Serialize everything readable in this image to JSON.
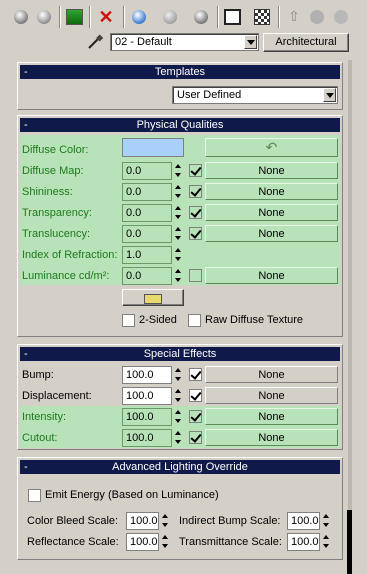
{
  "toolbar": {
    "icons": [
      "get-material-icon",
      "put-to-scene-icon",
      "assign-icon",
      "reset-icon",
      "copy-icon",
      "unique-icon",
      "put-to-library-icon",
      "material-effects-icon",
      "show-map-icon",
      "show-end-icon",
      "go-parent-icon",
      "go-sibling-icon"
    ]
  },
  "material_name": "02 - Default",
  "material_type": "Architectural",
  "templates": {
    "title": "Templates",
    "selected": "User Defined"
  },
  "physical": {
    "title": "Physical Qualities",
    "diffuse_color_label": "Diffuse Color:",
    "diffuse_color": "#a8d0f8",
    "diffuse_map_label": "Diffuse Map:",
    "diffuse_map_value": "0.0",
    "shininess_label": "Shininess:",
    "shininess_value": "0.0",
    "transparency_label": "Transparency:",
    "transparency_value": "0.0",
    "translucency_label": "Translucency:",
    "translucency_value": "0.0",
    "ior_label": "Index of Refraction:",
    "ior_value": "1.0",
    "luminance_label": "Luminance cd/m²:",
    "luminance_value": "0.0",
    "none": "None",
    "two_sided": "2-Sided",
    "raw_diffuse": "Raw Diffuse Texture"
  },
  "special": {
    "title": "Special Effects",
    "bump_label": "Bump:",
    "bump_value": "100.0",
    "displacement_label": "Displacement:",
    "displacement_value": "100.0",
    "intensity_label": "Intensity:",
    "intensity_value": "100.0",
    "cutout_label": "Cutout:",
    "cutout_value": "100.0",
    "none": "None"
  },
  "advanced": {
    "title": "Advanced Lighting Override",
    "emit_energy": "Emit Energy (Based on Luminance)",
    "color_bleed_label": "Color Bleed Scale:",
    "color_bleed_value": "100.0",
    "indirect_bump_label": "Indirect Bump Scale:",
    "indirect_bump_value": "100.0",
    "reflectance_label": "Reflectance Scale:",
    "reflectance_value": "100.0",
    "transmittance_label": "Transmittance Scale:",
    "transmittance_value": "100.0"
  },
  "minus": "-"
}
